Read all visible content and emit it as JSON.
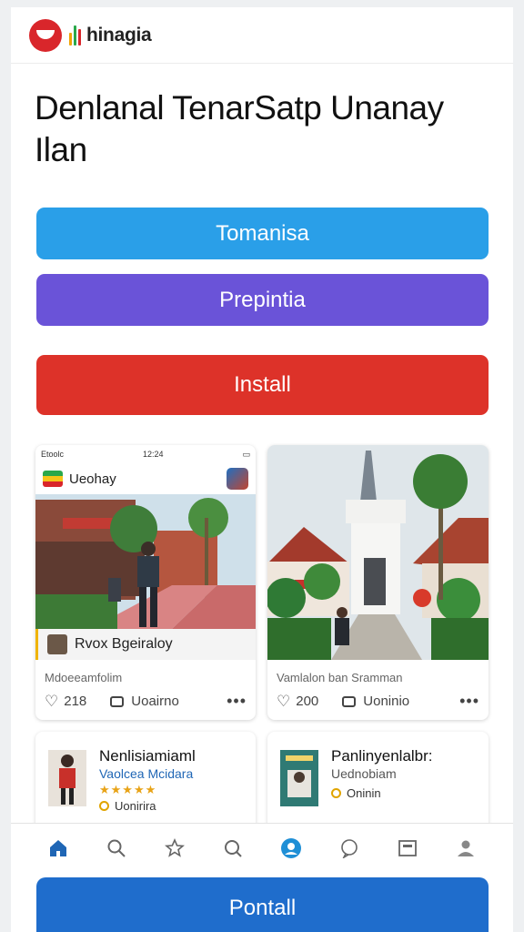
{
  "header": {
    "brand": "hinagia",
    "logo_icon": "brand-logo-icon"
  },
  "page_title": "Denlanal TenarSatp Unanay Ilan",
  "buttons": {
    "primary": "Tomanisa",
    "secondary": "Prepintia",
    "install": "Install",
    "bottom": "Pontall"
  },
  "colors": {
    "blue": "#2a9fe8",
    "purple": "#6a53d8",
    "red": "#dd3229",
    "nav_active": "#1f66b5",
    "bottom_button": "#1f6dcc"
  },
  "cards": [
    {
      "status_time": "12:24",
      "status_carrier": "Etoolc",
      "app_name": "Ueohay",
      "overlay_name": "Rvox Bgeiraloy",
      "subtitle": "Mdoeeamfolim",
      "likes": "218",
      "comment_label": "Uoairno",
      "more": "•••"
    },
    {
      "subtitle": "Vamlalon ban Sramman",
      "likes": "200",
      "comment_label": "Uoninio",
      "more": "•••"
    }
  ],
  "mini_cards": [
    {
      "title": "Nenlisiamiaml",
      "subtitle": "Vaolcea Mcidara",
      "stars": "★★★★★",
      "meta": "Uonirira"
    },
    {
      "title": "Panlinyenlalbr:",
      "subtitle": "Uednobiam",
      "meta": "Oninin"
    }
  ],
  "bottom_nav": [
    {
      "icon": "home-icon",
      "active": true
    },
    {
      "icon": "search-icon",
      "active": false
    },
    {
      "icon": "star-icon",
      "active": false
    },
    {
      "icon": "chat-icon",
      "active": false
    },
    {
      "icon": "user-circle-icon",
      "active": true
    },
    {
      "icon": "bubble-icon",
      "active": false
    },
    {
      "icon": "calendar-icon",
      "active": false
    },
    {
      "icon": "profile-icon",
      "active": false
    }
  ]
}
